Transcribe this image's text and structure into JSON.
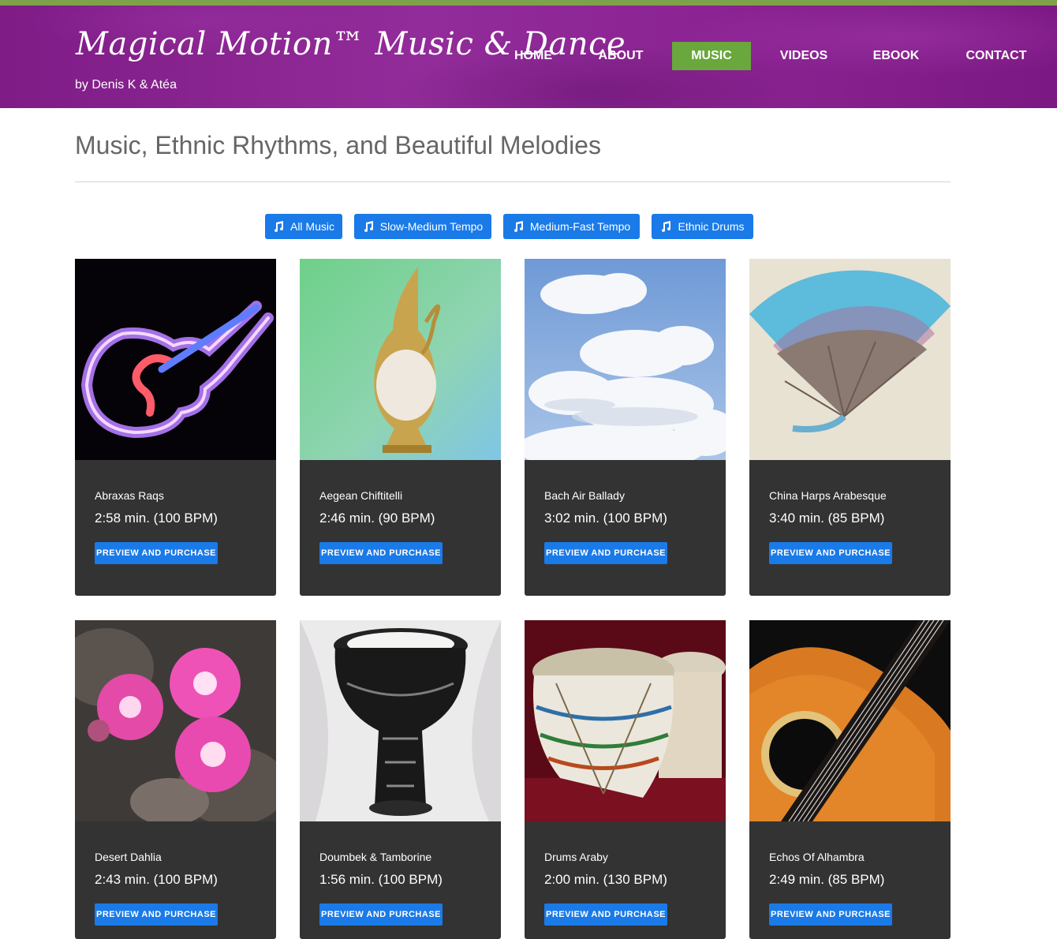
{
  "site": {
    "logo_text": "Magical Motion™ Music & Dance",
    "tagline": "by Denis K & Atéa"
  },
  "nav": {
    "items": [
      {
        "label": "HOME",
        "active": false
      },
      {
        "label": "ABOUT",
        "active": false
      },
      {
        "label": "MUSIC",
        "active": true
      },
      {
        "label": "VIDEOS",
        "active": false
      },
      {
        "label": "EBOOK",
        "active": false
      },
      {
        "label": "CONTACT",
        "active": false
      }
    ]
  },
  "page": {
    "title": "Music, Ethnic Rhythms, and Beautiful Melodies"
  },
  "filters": {
    "icon": "music-note-icon",
    "items": [
      {
        "label": "All Music"
      },
      {
        "label": "Slow-Medium Tempo"
      },
      {
        "label": "Medium-Fast Tempo"
      },
      {
        "label": "Ethnic Drums"
      }
    ]
  },
  "tracks": [
    {
      "title": "Abraxas Raqs",
      "meta": "2:58 min. (100 BPM)",
      "button": "PREVIEW AND PURCHASE",
      "image": "neon-guitar"
    },
    {
      "title": "Aegean Chiftitelli",
      "meta": "2:46 min. (90 BPM)",
      "button": "PREVIEW AND PURCHASE",
      "image": "brass-pitcher"
    },
    {
      "title": "Bach Air Ballady",
      "meta": "3:02 min. (100 BPM)",
      "button": "PREVIEW AND PURCHASE",
      "image": "cloudy-sky"
    },
    {
      "title": "China Harps Arabesque",
      "meta": "3:40 min. (85 BPM)",
      "button": "PREVIEW AND PURCHASE",
      "image": "folding-fan"
    },
    {
      "title": "Desert Dahlia",
      "meta": "2:43 min. (100 BPM)",
      "button": "PREVIEW AND PURCHASE",
      "image": "cactus-flowers"
    },
    {
      "title": "Doumbek & Tamborine",
      "meta": "1:56 min. (100 BPM)",
      "button": "PREVIEW AND PURCHASE",
      "image": "doumbek-drum"
    },
    {
      "title": "Drums Araby",
      "meta": "2:00 min. (130 BPM)",
      "button": "PREVIEW AND PURCHASE",
      "image": "clay-drums"
    },
    {
      "title": "Echos Of Alhambra",
      "meta": "2:49 min. (85 BPM)",
      "button": "PREVIEW AND PURCHASE",
      "image": "acoustic-guitar"
    }
  ],
  "colors": {
    "header_purple": "#8a2391",
    "nav_active": "#6aa73c",
    "accent_blue": "#1a7ae8",
    "card_bg": "#333333",
    "title_gray": "#666666"
  }
}
